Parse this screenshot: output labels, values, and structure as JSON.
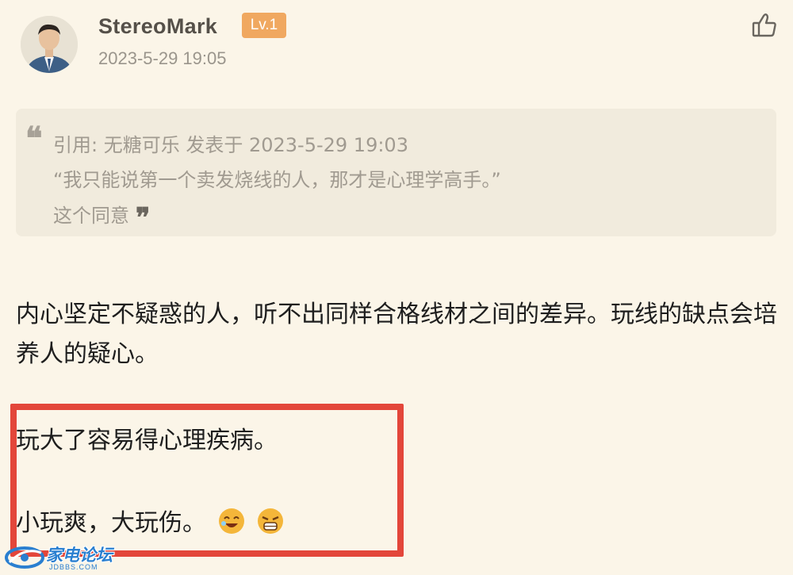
{
  "post": {
    "username": "StereoMark",
    "level": "Lv.1",
    "time": "2023-5-29 19:05"
  },
  "quote": {
    "header": "引用: 无糖可乐 发表于 2023-5-29 19:03",
    "text": "“我只能说第一个卖发烧线的人，那才是心理学高手。”",
    "reply": "这个同意",
    "open_mark": "❝",
    "close_mark": "❞"
  },
  "content": {
    "paragraph1": "内心坚定不疑惑的人，听不出同样合格线材之间的差异。玩线的缺点会培养人的疑心。",
    "line2": "玩大了容易得心理疾病。",
    "line3": "小玩爽，大玩伤。"
  },
  "colors": {
    "background": "#fbf5e8",
    "badge": "#f0a860",
    "highlight_border": "#e3463a",
    "quote_bg": "#f1ebdd"
  },
  "icons": {
    "like": "thumbs-up-icon",
    "emoji1": "laughing-emoji-icon",
    "emoji2": "crying-emoji-icon"
  },
  "watermark": {
    "title": "家电论坛",
    "sub": "JDBBS.COM"
  }
}
